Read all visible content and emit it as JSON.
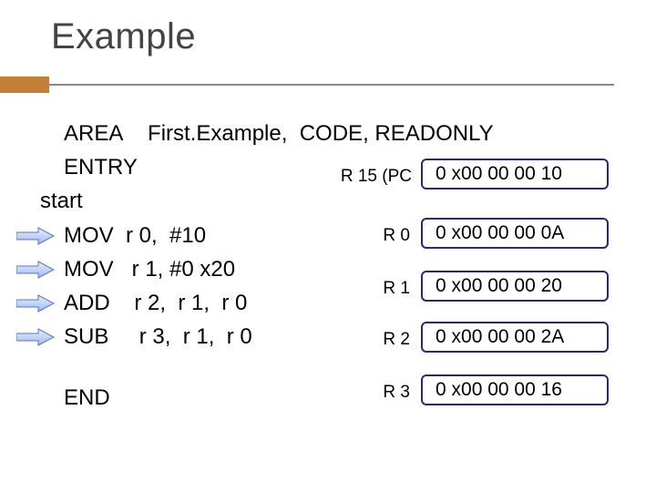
{
  "title": "Example",
  "code": {
    "line1": "AREA    First.Example,  CODE, READONLY",
    "line2": "ENTRY",
    "line3": "start",
    "mov0": "MOV  r 0,  #10",
    "mov1": "MOV   r 1, #0 x20",
    "add": "ADD    r 2,  r 1,  r 0",
    "sub": "SUB     r 3,  r 1,  r 0",
    "end": "END"
  },
  "registers": [
    {
      "label": "R 15 (PC",
      "value": "0 x00 00 00 10"
    },
    {
      "label": "R 0",
      "value": "0 x00 00 00 0A"
    },
    {
      "label": "R 1",
      "value": "0 x00 00 00 20"
    },
    {
      "label": "R 2",
      "value": "0 x00 00 00 2A"
    },
    {
      "label": "R 3",
      "value": "0 x00 00 00 16"
    }
  ]
}
